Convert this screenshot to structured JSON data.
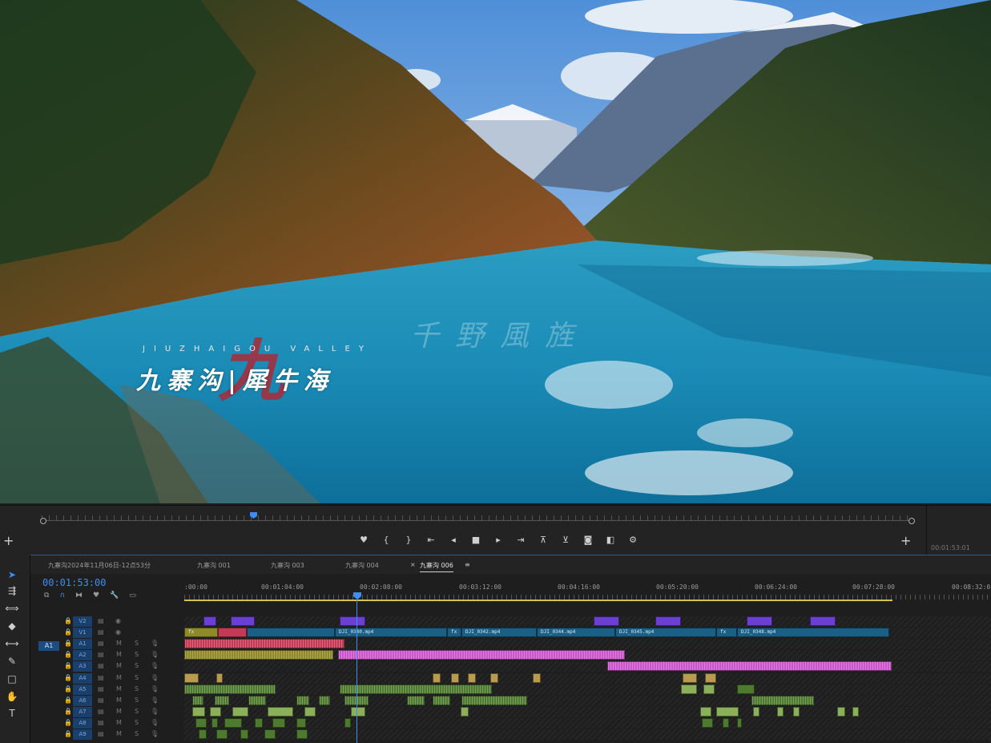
{
  "monitor": {
    "subtitle_en": "JIUZHAIGOU VALLEY",
    "title_cn": "九寨沟|犀牛海",
    "watermark": "千野風旌",
    "stylized_char": "九"
  },
  "controls": {
    "timecode_small": "00:01:53:01"
  },
  "timeline": {
    "timecode": "00:01:53:00",
    "tabs": [
      "九寨沟2024年11月06日-12点53分",
      "九寨沟 001",
      "九寨沟 003",
      "九寨沟 004",
      "九寨沟 006"
    ],
    "active_tab": 4,
    "ruler": [
      ":00:00",
      "00:01:04:00",
      "00:02:08:00",
      "00:03:12:00",
      "00:04:16:00",
      "00:05:20:00",
      "00:06:24:00",
      "00:07:28:00",
      "00:08:32:0"
    ],
    "source_patch": "A1",
    "tracks": [
      {
        "name": "V2",
        "type": "video"
      },
      {
        "name": "V1",
        "type": "video"
      },
      {
        "name": "A1",
        "type": "audio"
      },
      {
        "name": "A2",
        "type": "audio"
      },
      {
        "name": "A3",
        "type": "audio"
      },
      {
        "name": "A4",
        "type": "audio"
      },
      {
        "name": "A5",
        "type": "audio"
      },
      {
        "name": "A6",
        "type": "audio"
      },
      {
        "name": "A7",
        "type": "audio"
      },
      {
        "name": "A8",
        "type": "audio"
      },
      {
        "name": "A9",
        "type": "audio"
      }
    ],
    "clip_labels": [
      "DJI_0340.mp4",
      "DJI_0342.mp4",
      "DJI_0344.mp4",
      "DJI_0345.mp4",
      "DJI_0348.mp4"
    ],
    "track_toggle_m": "M",
    "track_toggle_s": "S",
    "fx_badge": "fx"
  }
}
